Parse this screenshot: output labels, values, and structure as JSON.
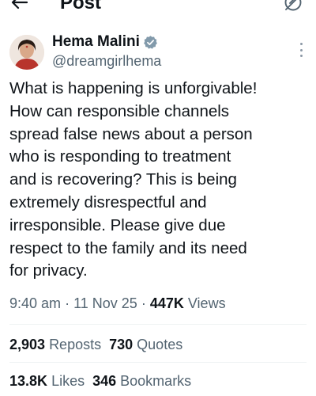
{
  "header": {
    "title": "Post",
    "back_icon": "arrow-left-icon",
    "right_icon": "grok-icon"
  },
  "author": {
    "name": "Hema Malini",
    "handle": "@dreamgirlhema",
    "verified_color": "#829aab"
  },
  "tweet": {
    "text": "What is happening is unforgivable!\nHow can responsible channels\nspread false news about a person\nwho is responding to treatment\nand is recovering? This is being\nextremely disrespectful and\nirresponsible. Please give due\nrespect to the family and its need\nfor privacy."
  },
  "meta": {
    "time": "9:40 am",
    "date": "11 Nov 25",
    "separator": "·",
    "views_count": "447K",
    "views_label": "Views"
  },
  "stats_row1": {
    "reposts_count": "2,903",
    "reposts_label": "Reposts",
    "quotes_count": "730",
    "quotes_label": "Quotes"
  },
  "stats_row2": {
    "likes_count": "13.8K",
    "likes_label": "Likes",
    "bookmarks_count": "346",
    "bookmarks_label": "Bookmarks"
  },
  "colors": {
    "text": "#0f1419",
    "secondary": "#536471",
    "divider": "#eff3f4"
  }
}
